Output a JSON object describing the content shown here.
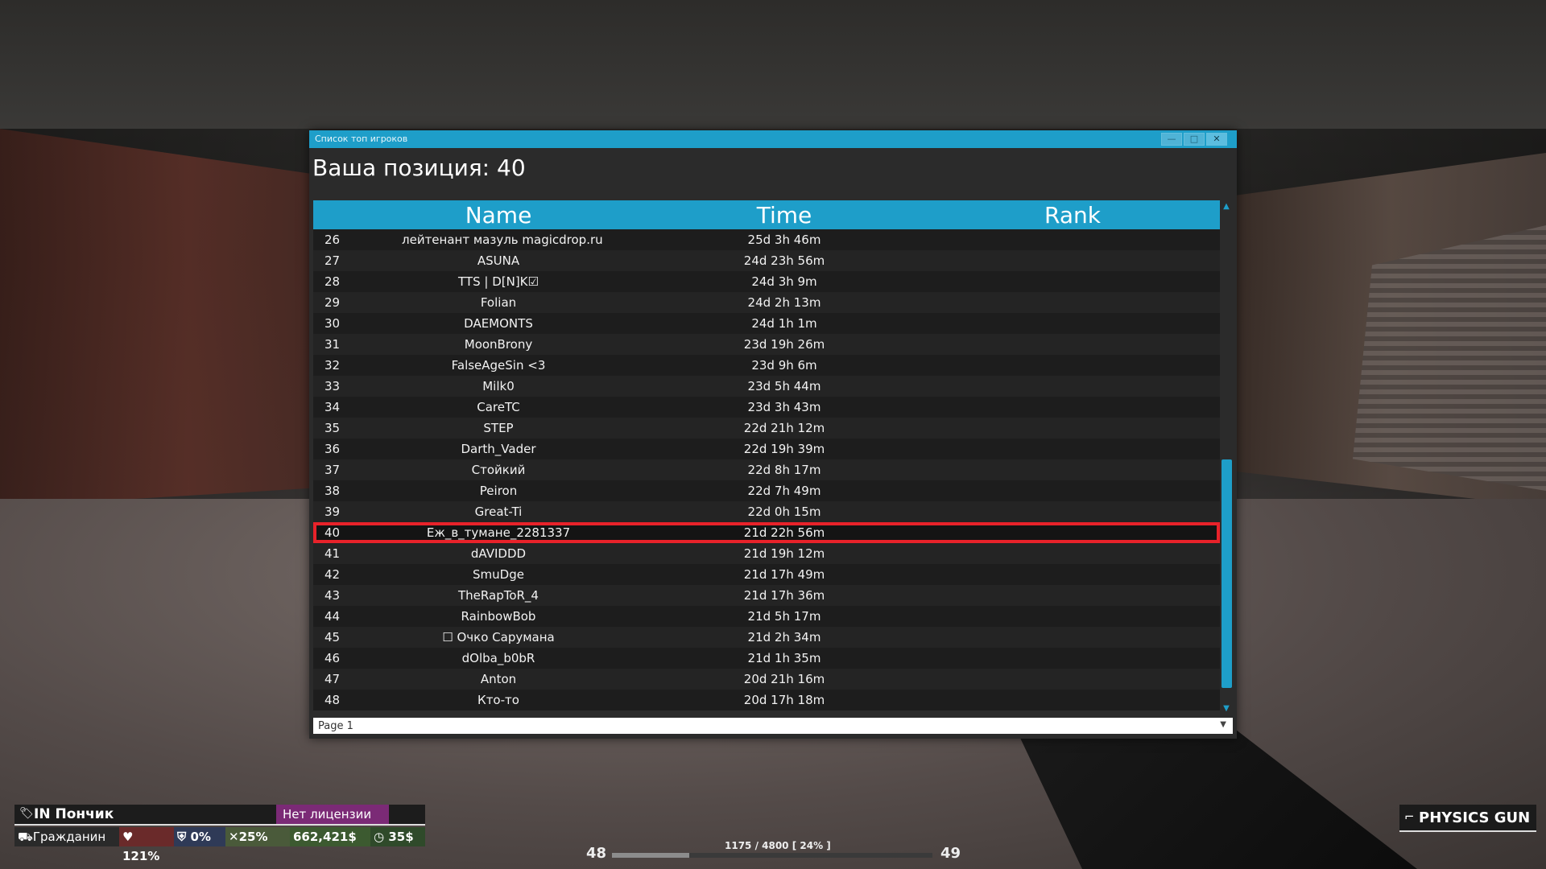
{
  "window": {
    "title": "Список топ игроков",
    "position_text": "Ваша позиция: 40",
    "controls": {
      "minimize": "—",
      "maximize": "□",
      "close": "✕"
    }
  },
  "table": {
    "headers": {
      "name": "Name",
      "time": "Time",
      "rank": "Rank"
    },
    "highlight_rank": 40,
    "rows": [
      {
        "num": "26",
        "name": "лейтенант мазуль magicdrop.ru",
        "time": "25d 3h 46m",
        "rank": ""
      },
      {
        "num": "27",
        "name": "ASUNA",
        "time": "24d 23h 56m",
        "rank": ""
      },
      {
        "num": "28",
        "name": "TTS | D[N]K☑",
        "time": "24d 3h 9m",
        "rank": ""
      },
      {
        "num": "29",
        "name": "Folian",
        "time": "24d 2h 13m",
        "rank": ""
      },
      {
        "num": "30",
        "name": "DAEMONTS",
        "time": "24d 1h 1m",
        "rank": ""
      },
      {
        "num": "31",
        "name": "MoonBrony",
        "time": "23d 19h 26m",
        "rank": ""
      },
      {
        "num": "32",
        "name": "FalseAgeSin <3",
        "time": "23d 9h 6m",
        "rank": ""
      },
      {
        "num": "33",
        "name": "Milk0",
        "time": "23d 5h 44m",
        "rank": ""
      },
      {
        "num": "34",
        "name": "CareTC",
        "time": "23d 3h 43m",
        "rank": ""
      },
      {
        "num": "35",
        "name": "STEP",
        "time": "22d 21h 12m",
        "rank": ""
      },
      {
        "num": "36",
        "name": "Darth_Vader",
        "time": "22d 19h 39m",
        "rank": ""
      },
      {
        "num": "37",
        "name": "Стойкий",
        "time": "22d 8h 17m",
        "rank": ""
      },
      {
        "num": "38",
        "name": "Peiron",
        "time": "22d 7h 49m",
        "rank": ""
      },
      {
        "num": "39",
        "name": "Great-Ti",
        "time": "22d 0h 15m",
        "rank": ""
      },
      {
        "num": "40",
        "name": "Еж_в_тумане_2281337",
        "time": "21d 22h 56m",
        "rank": ""
      },
      {
        "num": "41",
        "name": "dAVIDDD",
        "time": "21d 19h 12m",
        "rank": ""
      },
      {
        "num": "42",
        "name": "SmuDge",
        "time": "21d 17h 49m",
        "rank": ""
      },
      {
        "num": "43",
        "name": "TheRapToR_4",
        "time": "21d 17h 36m",
        "rank": ""
      },
      {
        "num": "44",
        "name": "RainbowBob",
        "time": "21d 5h 17m",
        "rank": ""
      },
      {
        "num": "45",
        "name": "☐ Очко Сарумана",
        "time": "21d 2h 34m",
        "rank": ""
      },
      {
        "num": "46",
        "name": "dOlba_b0bR",
        "time": "21d 1h 35m",
        "rank": ""
      },
      {
        "num": "47",
        "name": "Anton",
        "time": "20d 21h 16m",
        "rank": ""
      },
      {
        "num": "48",
        "name": "Кто-то",
        "time": "20d 17h 18m",
        "rank": ""
      }
    ]
  },
  "pager": {
    "value": "Page 1"
  },
  "hud": {
    "player_name": "IN Пончик",
    "license": "Нет лицензии",
    "job": "Гражданин",
    "health": "121%",
    "armor": "0%",
    "hunger": "25%",
    "money": "662,421$",
    "salary": "35$"
  },
  "xp": {
    "level_current": "48",
    "level_next": "49",
    "text": "1175 / 4800 [ 24% ]",
    "progress": 0.24
  },
  "weapon": {
    "label": "PHYSICS GUN"
  },
  "colors": {
    "accent": "#1e9ec9",
    "highlight": "#e8222a",
    "license": "#7b2a76"
  }
}
